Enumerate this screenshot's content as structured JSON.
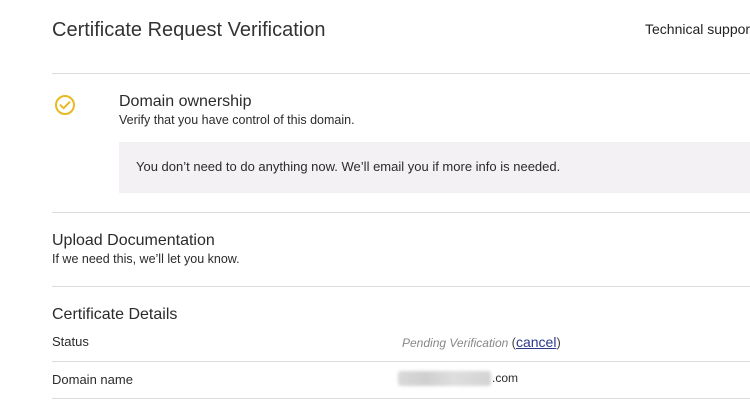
{
  "header": {
    "title": "Certificate Request Verification",
    "support_link": "Technical support"
  },
  "domain_ownership": {
    "icon": "check-circle-icon",
    "icon_color": "#e8b923",
    "title": "Domain ownership",
    "subtitle": "Verify that you have control of this domain.",
    "notice": "You don’t need to do anything now. We’ll email you if more info is needed."
  },
  "upload_documentation": {
    "title": "Upload Documentation",
    "subtitle": "If we need this, we’ll let you know."
  },
  "certificate_details": {
    "title": "Certificate Details",
    "status_label": "Status",
    "status_value": "Pending Verification",
    "status_paren_open": "(",
    "cancel_label": "cancel",
    "status_paren_close": ")",
    "domain_label": "Domain name",
    "domain_suffix": ".com"
  },
  "colors": {
    "link": "#2b3a8c",
    "notice_background": "#f3f1f3"
  }
}
